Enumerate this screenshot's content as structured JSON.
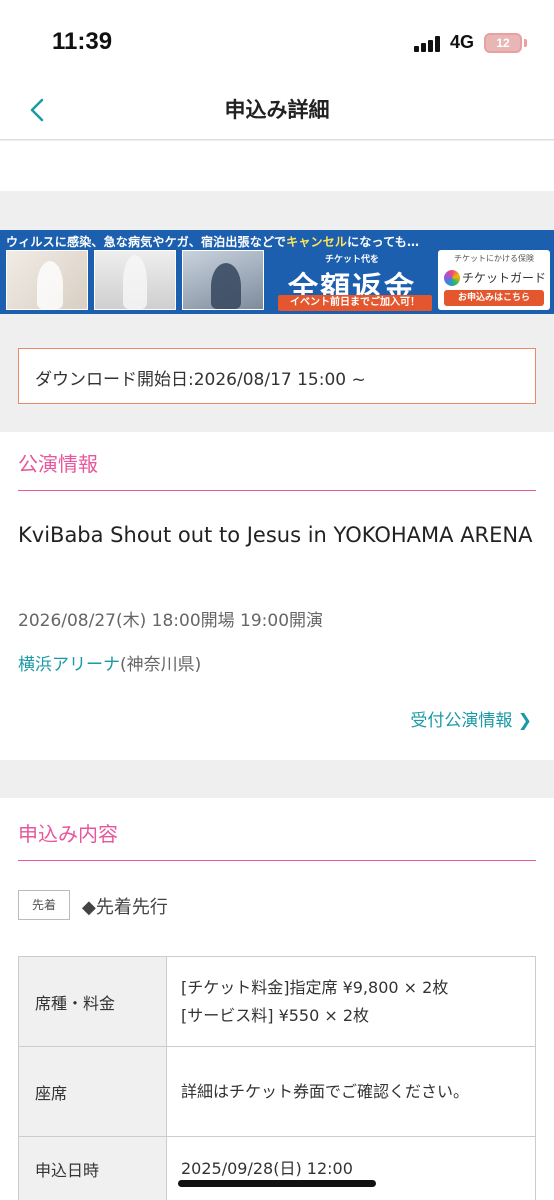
{
  "status_bar": {
    "time": "11:39",
    "network": "4G",
    "battery": "12"
  },
  "nav": {
    "title": "申込み詳細",
    "back_icon": "chevron-left-icon"
  },
  "banner": {
    "headline_part1": "ウィルスに感染、急な病気やケガ、宿泊出張などで",
    "headline_accent": "キャンセル",
    "headline_part2": "になっても…",
    "refund_sub": "チケット代を",
    "refund_main": "全額返金",
    "refund_bar": "イベント前日までご加入可！",
    "guard_small": "チケットにかける保険",
    "guard_name": "チケットガード",
    "guard_button": "お申込みはこちら"
  },
  "download_notice": "ダウンロード開始日:2026/08/17 15:00 ~",
  "performance": {
    "section_title": "公演情報",
    "event_title": "KviBaba Shout out to Jesus in YOKOHAMA ARENA",
    "datetime": "2026/08/27(木) 18:00開場 19:00開演",
    "venue_name": "横浜アリーナ",
    "venue_pref": "(神奈川県)",
    "link_label": "受付公演情報 ❯"
  },
  "application": {
    "section_title": "申込み内容",
    "tag": "先着",
    "type": "◆先着先行",
    "rows": [
      {
        "key": "席種・料金",
        "value_1": "[チケット料金]指定席 ¥9,800 × 2枚",
        "value_2": "[サービス料] ¥550 × 2枚"
      },
      {
        "key": "座席",
        "value_1": "詳細はチケット券面でご確認ください。"
      },
      {
        "key": "申込日時",
        "value_1": "2025/09/28(日) 12:00"
      }
    ]
  },
  "colors": {
    "accent_pink": "#e8579b",
    "link_teal": "#1a9aa6",
    "notice_border": "#e88a6a",
    "banner_blue": "#1c5fae"
  }
}
